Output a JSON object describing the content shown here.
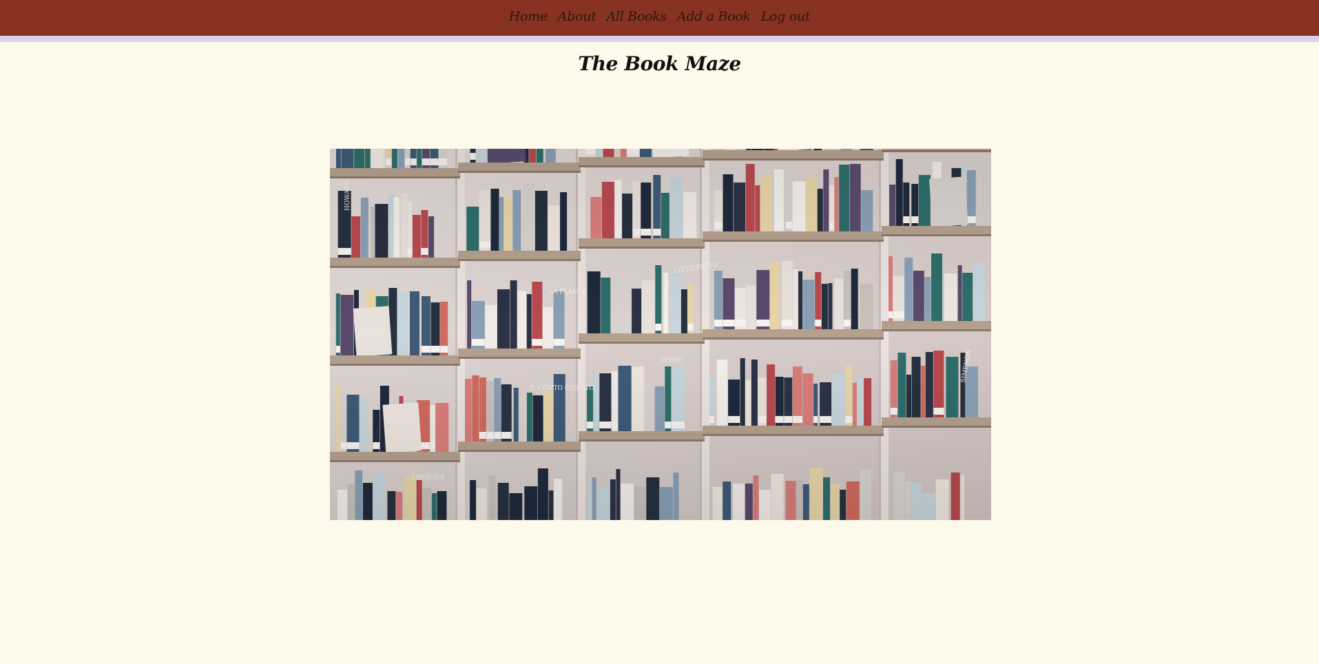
{
  "nav": {
    "items": [
      {
        "label": "Home"
      },
      {
        "label": "About"
      },
      {
        "label": "All Books"
      },
      {
        "label": "Add a Book"
      },
      {
        "label": "Log out"
      }
    ]
  },
  "header": {
    "title": "The Book Maze"
  },
  "hero": {
    "image_name": "bookshelf-photo",
    "book_titles": [
      "HOWARD",
      "LA PLANTE",
      "LITTIZZETTO",
      "IL CONTO CIFRATO",
      "THEROUX",
      "ROSSI",
      "SIMENON"
    ]
  },
  "colors": {
    "nav_bg": "#883321",
    "nav_stripe": "#ddd2ea",
    "page_bg": "#fdf9eb",
    "nav_text": "#2d1610"
  }
}
